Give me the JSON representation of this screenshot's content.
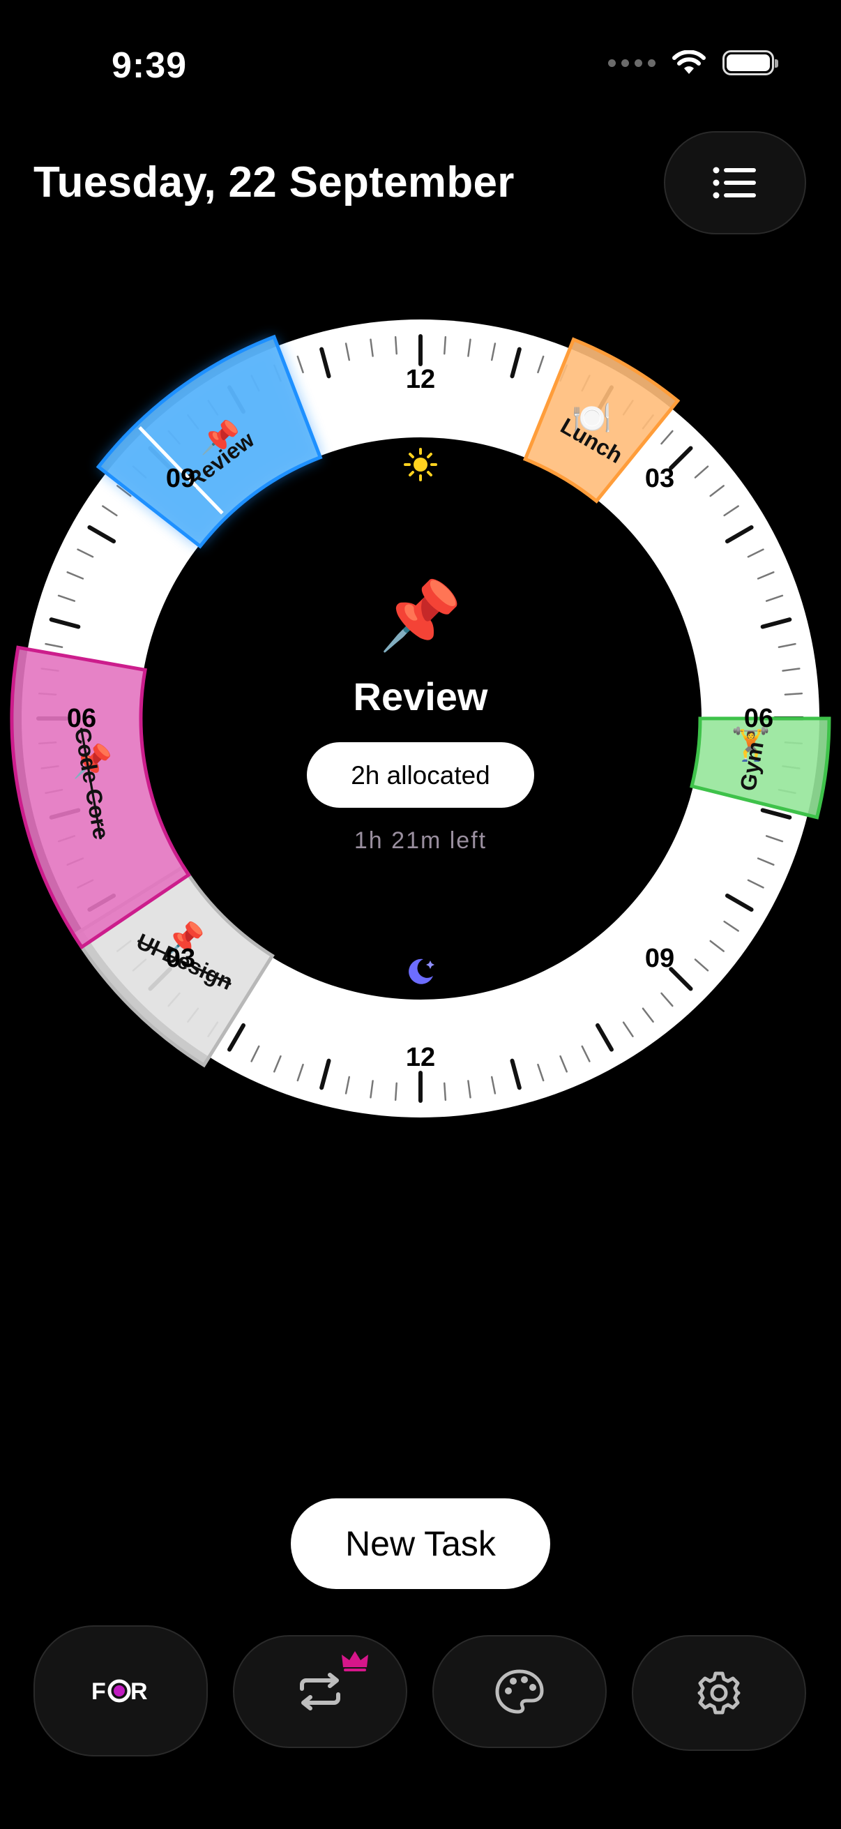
{
  "status_bar": {
    "time": "9:39"
  },
  "header": {
    "date": "Tuesday, 22 September",
    "list_icon": "list-icon"
  },
  "clock": {
    "top_labels": [
      "12",
      "03",
      "06",
      "09"
    ],
    "bottom_labels": [
      "12",
      "09",
      "06",
      "03"
    ],
    "day_icon": "sun-icon",
    "night_icon": "moon-icon",
    "tasks": [
      {
        "name": "Review",
        "emoji": "📌",
        "color": "#5db6fb",
        "stroke": "#1e90ff",
        "strikethrough": false
      },
      {
        "name": "Lunch",
        "emoji": "🍽️",
        "color": "#ffbd7a",
        "stroke": "#ff9d3a",
        "strikethrough": false
      },
      {
        "name": "Gym",
        "emoji": "🏋️",
        "color": "#96e59a",
        "stroke": "#3ec24a",
        "strikethrough": false
      },
      {
        "name": "UI Design",
        "emoji": "📌",
        "color": "#e0e0e0",
        "stroke": "#b8b8b8",
        "strikethrough": true
      },
      {
        "name": "Code Core",
        "emoji": "📌",
        "color": "#e374c0",
        "stroke": "#cc1d8c",
        "strikethrough": true
      }
    ]
  },
  "center": {
    "emoji": "📌",
    "task_name": "Review",
    "allocated": "2h allocated",
    "left": "1h 21m left"
  },
  "new_task_label": "New Task",
  "tabs": [
    {
      "label": "FOR",
      "icon": "focus-logo-icon"
    },
    {
      "icon": "repeat-icon",
      "badge": "crown-icon"
    },
    {
      "icon": "palette-icon"
    },
    {
      "icon": "gear-icon"
    }
  ],
  "accent": "#ffffff"
}
